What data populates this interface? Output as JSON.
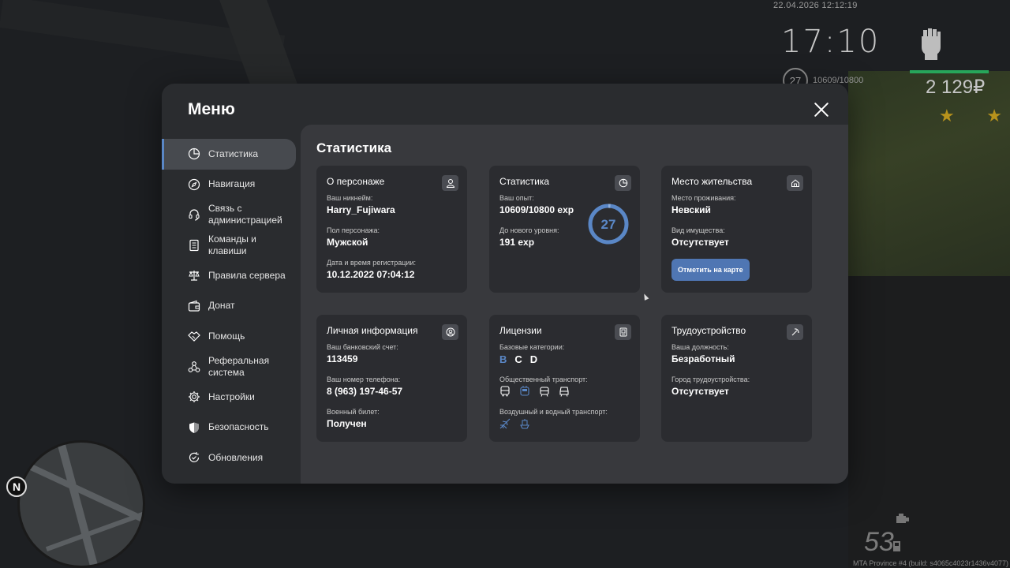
{
  "hud": {
    "datetime": "22.04.2026 12:12:19",
    "clock": "17:10",
    "level": "27",
    "exp": "10609/10800",
    "money": "2 129₽",
    "speed": "53",
    "build": "MTA Province #4 (build: s4065c4023r1436v4077)",
    "compass": "N"
  },
  "menu": {
    "title": "Меню",
    "close_icon": "close-icon"
  },
  "sidebar": {
    "items": [
      {
        "label": "Статистика",
        "icon": "pie-chart-icon",
        "active": true
      },
      {
        "label": "Навигация",
        "icon": "compass-icon"
      },
      {
        "label": "Связь с администрацией",
        "icon": "headset-icon"
      },
      {
        "label": "Команды и клавиши",
        "icon": "document-icon"
      },
      {
        "label": "Правила сервера",
        "icon": "scales-icon"
      },
      {
        "label": "Донат",
        "icon": "wallet-icon"
      },
      {
        "label": "Помощь",
        "icon": "handshake-icon"
      },
      {
        "label": "Реферальная система",
        "icon": "network-icon"
      },
      {
        "label": "Настройки",
        "icon": "gear-icon"
      },
      {
        "label": "Безопасность",
        "icon": "shield-icon"
      },
      {
        "label": "Обновления",
        "icon": "refresh-icon"
      }
    ]
  },
  "content": {
    "title": "Статистика",
    "character": {
      "title": "О персонаже",
      "nickname_label": "Ваш никнейм:",
      "nickname": "Harry_Fujiwara",
      "gender_label": "Пол персонажа:",
      "gender": "Мужской",
      "reg_label": "Дата и время регистрации:",
      "reg": "10.12.2022 07:04:12"
    },
    "stats": {
      "title": "Статистика",
      "exp_label": "Ваш опыт:",
      "exp": "10609/10800 exp",
      "next_label": "До нового уровня:",
      "next": "191 exp",
      "level": "27",
      "progress": 0.982
    },
    "residence": {
      "title": "Место жительства",
      "place_label": "Место проживания:",
      "place": "Невский",
      "property_label": "Вид имущества:",
      "property": "Отсутствует",
      "map_button": "Отметить на карте"
    },
    "personal": {
      "title": "Личная информация",
      "bank_label": "Ваш банковский счет:",
      "bank": "113459",
      "phone_label": "Ваш номер телефона:",
      "phone": "8 (963) 197-46-57",
      "military_label": "Военный билет:",
      "military": "Получен"
    },
    "licenses": {
      "title": "Лицензии",
      "base_label": "Базовые категории:",
      "cat_b": "B",
      "cat_c": "C",
      "cat_d": "D",
      "public_label": "Общественный транспорт:",
      "air_label": "Воздушный и водный транспорт:"
    },
    "employment": {
      "title": "Трудоустройство",
      "position_label": "Ваша должность:",
      "position": "Безработный",
      "city_label": "Город трудоустройства:",
      "city": "Отсутствует"
    }
  },
  "colors": {
    "accent": "#5a87c6",
    "button": "#4f76b3",
    "star": "#b8931c",
    "health": "#27a55a"
  }
}
